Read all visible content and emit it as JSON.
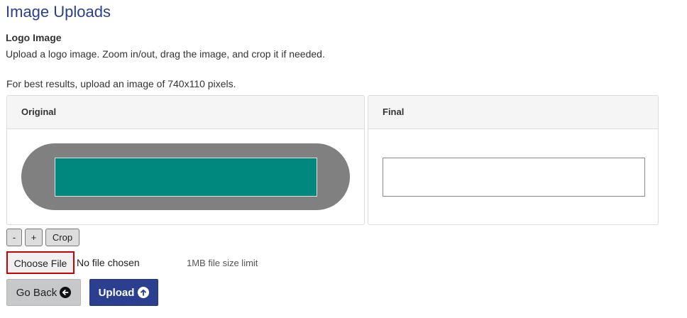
{
  "page": {
    "title": "Image Uploads"
  },
  "logo_section": {
    "label": "Logo Image",
    "instructions": "Upload a logo image. Zoom in/out, drag the image, and crop it if needed.",
    "best_results": "For best results, upload an image of 740x110 pixels."
  },
  "panels": {
    "original_label": "Original",
    "final_label": "Final"
  },
  "image_colors": {
    "stage_background": "#808080",
    "image_fill": "#00887f"
  },
  "tools": {
    "zoom_out_label": "-",
    "zoom_in_label": "+",
    "crop_label": "Crop"
  },
  "file_input": {
    "button_label": "Choose File",
    "status": "No file chosen",
    "size_limit": "1MB file size limit"
  },
  "actions": {
    "go_back_label": "Go Back",
    "go_back_icon": "arrow-left-circle-icon",
    "upload_label": "Upload",
    "upload_icon": "arrow-up-circle-icon",
    "primary_color": "#2a3f8f"
  }
}
